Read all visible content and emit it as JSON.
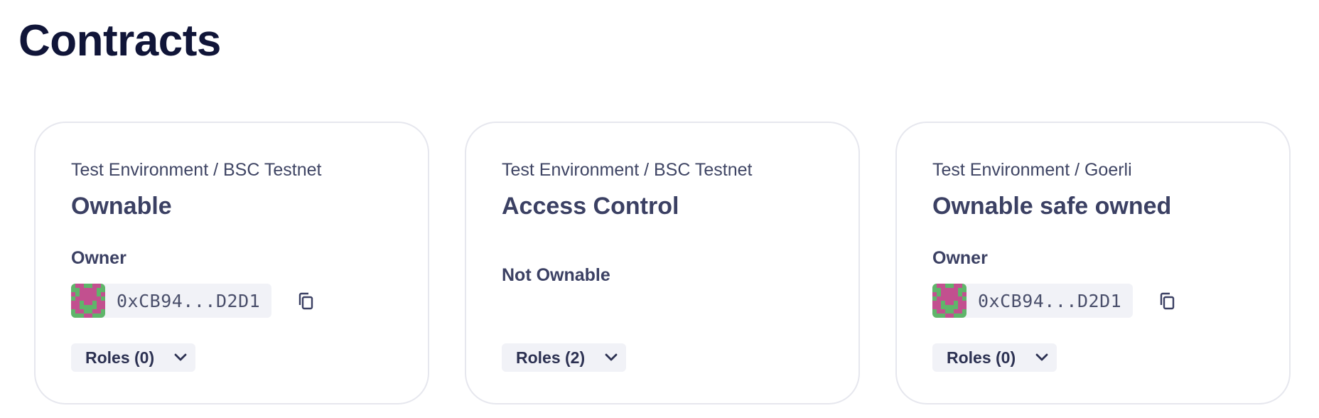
{
  "page": {
    "title": "Contracts"
  },
  "cards": [
    {
      "breadcrumb": "Test Environment / BSC Testnet",
      "name": "Ownable",
      "owner_label": "Owner",
      "owner_address": "0xCB94...D2D1",
      "roles_label": "Roles (0)"
    },
    {
      "breadcrumb": "Test Environment / BSC Testnet",
      "name": "Access Control",
      "ownership_status": "Not Ownable",
      "roles_label": "Roles (2)"
    },
    {
      "breadcrumb": "Test Environment / Goerli",
      "name": "Ownable safe owned",
      "owner_label": "Owner",
      "owner_address": "0xCB94...D2D1",
      "roles_label": "Roles (0)"
    }
  ],
  "icons": {
    "copy": "copy-icon",
    "chevron": "chevron-down-icon",
    "avatar": "identicon-avatar"
  },
  "colors": {
    "title": "#101538",
    "card_border": "#e6e7ee",
    "pill_bg": "#f1f2f7",
    "identicon_green": "#5fb56a",
    "identicon_magenta": "#c2508f"
  }
}
